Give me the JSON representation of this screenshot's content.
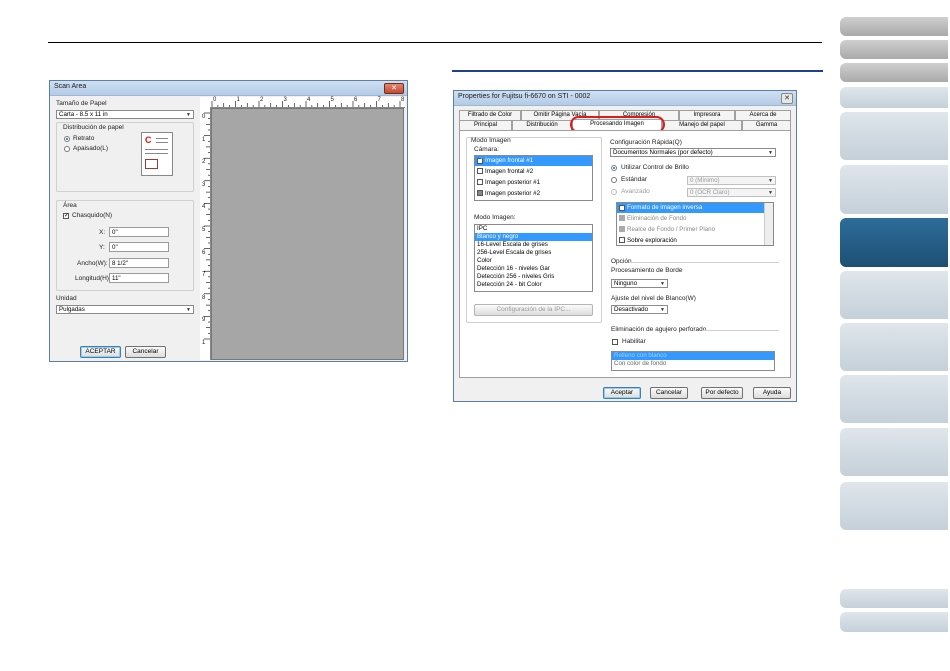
{
  "scan_area": {
    "title": "Scan Area",
    "paper_size_label": "Tamaño de Papel",
    "paper_size_value": "Carta - 8.5 x 11 in",
    "layout_label": "Distribución de papel",
    "portrait": "Retrato",
    "landscape": "Apaisado(L)",
    "area_label": "Área",
    "snap_label": "Chasquido(N)",
    "x_label": "X:",
    "x_value": "0\"",
    "y_label": "Y:",
    "y_value": "0\"",
    "width_label": "Ancho(W):",
    "width_value": "8 1/2\"",
    "length_label": "Longitud(H):",
    "length_value": "11\"",
    "unit_label": "Unidad",
    "unit_value": "Pulgadas",
    "ok_button": "ACEPTAR",
    "cancel_button": "Cancelar",
    "ruler_h": [
      "0",
      "1",
      "2",
      "3",
      "4",
      "5",
      "6",
      "7",
      "8"
    ],
    "ruler_v": [
      "0",
      "1",
      "2",
      "3",
      "4",
      "5",
      "6",
      "7",
      "8",
      "9",
      "1"
    ]
  },
  "properties": {
    "title": "Properties for Fujitsu fi-6670 on STI - 0002",
    "tabs_back": [
      "Filtrado de Color",
      "Omitir Página Vacía",
      "Compresión",
      "Impresora",
      "Acerca de"
    ],
    "tabs_front": [
      "Principal",
      "Distribución",
      "Procesando Imagen",
      "Manejo del papel",
      "Gamma"
    ],
    "image_mode_label": "Modo Imagen",
    "camera_label": "Cámara:",
    "cameras": [
      "Imagen frontal #1",
      "Imagen frontal #2",
      "Imagen posterior #1",
      "Imagen posterior #2"
    ],
    "image_mode_sub": "Modo Imagen:",
    "modes": [
      "IPC",
      "Blanco y negro",
      "16-Level Escala de grises",
      "256-Level Escala de grises",
      "Color",
      "Detección 16 - niveles Gar",
      "Detección 256 - niveles Gris",
      "Detección 24 - bit Color"
    ],
    "ipc_button": "Configuración de la IPC...",
    "quick_config_label": "Configuración Rápida(Q)",
    "quick_config_value": "Documentos Normales (por defecto)",
    "use_brightness": "Utilizar Control de Brillo",
    "standard_label": "Estándar",
    "standard_value": "0 (Mínimo)",
    "advanced_label": "Avanzado",
    "advanced_value": "0 (OCR Claro)",
    "features": [
      "Formato de imagen inversa",
      "Eliminación de Fondo",
      "Realce de Fondo / Primer Plano",
      "Sobre exploración"
    ],
    "option_label": "Opción",
    "edge_label": "Procesamiento de Borde",
    "edge_value": "Ninguno",
    "white_level_label": "Ajuste del nivel de Blanco(W)",
    "white_level_value": "Desactivado",
    "punch_label": "Eliminación de agujero perforado",
    "enable_label": "Habilitar",
    "punch_items": [
      "Relleno con blanco",
      "Con color de fondo"
    ],
    "accept_button": "Aceptar",
    "cancel_button": "Cancelar",
    "default_button": "Por defecto",
    "help_button": "Ayuda"
  }
}
